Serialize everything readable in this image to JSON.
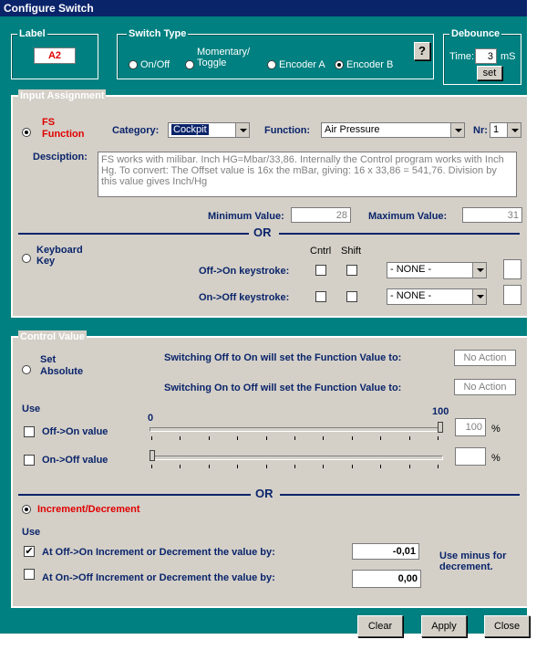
{
  "window": {
    "title": "Configure Switch"
  },
  "label_group": {
    "title": "Label",
    "value": "A2"
  },
  "switch_type": {
    "title": "Switch Type",
    "help": "?",
    "options": [
      "On/Off",
      "Momentary/ Toggle",
      "Encoder A",
      "Encoder B"
    ],
    "selected": "Encoder B"
  },
  "debounce": {
    "title": "Debounce",
    "time_label": "Time:",
    "value": "3",
    "unit": "mS",
    "set_label": "set"
  },
  "input": {
    "title": "Input Assignment",
    "fs_radio": "FS Function",
    "fs_line1": "FS",
    "fs_line2": "Function",
    "category_label": "Category:",
    "category_value": "Cockpit",
    "function_label": "Function:",
    "function_value": "Air Pressure",
    "nr_label": "Nr:",
    "nr_value": "1",
    "description_label": "Desciption:",
    "description": "FS works with milibar. Inch HG=Mbar/33,86. Internally the Control program works with Inch Hg. To convert: The Offset value is 16x the mBar, giving: 16 x 33,86 = 541,76. Division by this value gives Inch/Hg",
    "min_label": "Minimum Value:",
    "min_value": "28",
    "max_label": "Maximum Value:",
    "max_value": "31",
    "or": "OR",
    "kb_line1": "Keyboard",
    "kb_line2": "Key",
    "cntrl": "Cntrl",
    "shift": "Shift",
    "off_on_label": "Off->On keystroke:",
    "on_off_label": "On->Off keystroke:",
    "key1": "- NONE -",
    "key2": "- NONE -"
  },
  "control": {
    "title": "Control Value",
    "set_line1": "Set",
    "set_line2": "Absolute",
    "sw_off_on": "Switching Off to On will set the Function Value to:",
    "sw_on_off": "Switching On to Off will set the Function Value to:",
    "no_action1": "No Action",
    "no_action2": "No Action",
    "use": "Use",
    "scale_min": "0",
    "scale_max": "100",
    "off_on_value": "Off->On value",
    "on_off_value": "On->Off value",
    "pct1": "100",
    "pct2": "",
    "pct": "%",
    "slider1_fraction": 1.0,
    "slider2_fraction": 0.0,
    "or": "OR",
    "incdec": "Increment/Decrement",
    "use2": "Use",
    "inc1_label": "At Off->On Increment or Decrement the value by:",
    "inc1_value": "-0,01",
    "inc2_label": "At On->Off Increment or Decrement the value by:",
    "inc2_value": "0,00",
    "note": "Use minus for decrement."
  },
  "buttons": {
    "clear": "Clear",
    "apply": "Apply",
    "close": "Close"
  }
}
